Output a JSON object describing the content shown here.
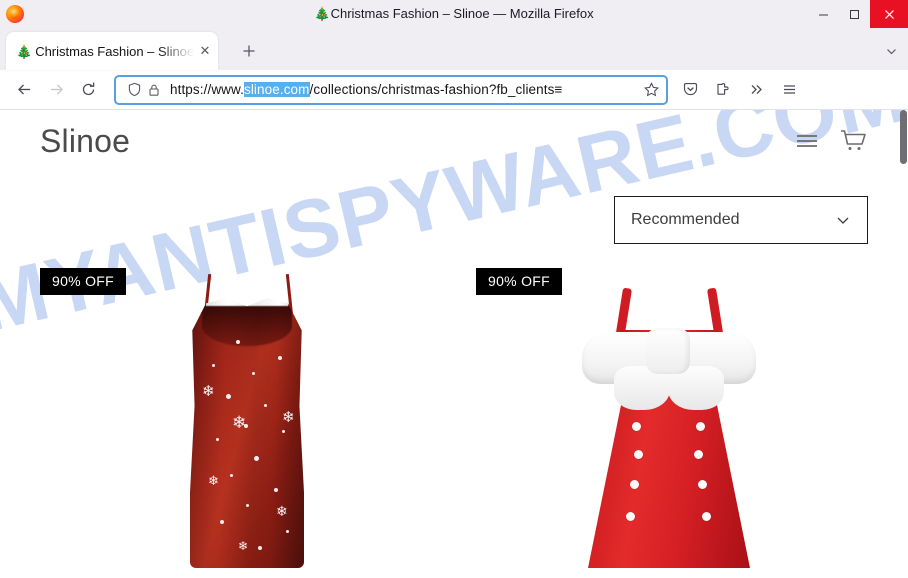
{
  "window": {
    "title": "🎄Christmas Fashion – Slinoe — Mozilla Firefox",
    "app_icon": "firefox-logo",
    "controls": {
      "minimize": "minimize-icon",
      "maximize": "maximize-icon",
      "close": "close-icon"
    }
  },
  "tabs": {
    "items": [
      {
        "favicon": "🎄",
        "title": "Christmas Fashion – Slinoe",
        "close_label": "✕",
        "active": true
      }
    ],
    "new_tab_label": "+",
    "tab_list_label": "⌄"
  },
  "toolbar": {
    "back_label": "←",
    "forward_label": "→",
    "reload_label": "⟳",
    "shield_icon": "tracking-protection-shield-icon",
    "lock_icon": "connection-secure-lock-icon",
    "url_prefix": "https://www.",
    "url_domain": "slinoe.com",
    "url_path": "/collections/christmas-fashion?fb_clients≡",
    "star_icon": "bookmark-star-icon",
    "pocket_icon": "save-to-pocket-icon",
    "extensions_icon": "extensions-puzzle-icon",
    "overflow_label": "»",
    "menu_icon": "application-menu-icon"
  },
  "page": {
    "watermark": "MYANTISPYWARE.COM",
    "watermark_color": "#b9cdf2",
    "site_logo": "Slinoe",
    "header": {
      "menu_icon": "hamburger-menu-icon",
      "cart_icon": "shopping-cart-icon"
    },
    "sort": {
      "selected": "Recommended",
      "chevron": "chevron-down-icon"
    },
    "products": [
      {
        "badge": "90% OFF",
        "badge_bg": "#000000",
        "image_alt": "dark-red-satin-snowflake-slip-dress"
      },
      {
        "badge": "90% OFF",
        "badge_bg": "#000000",
        "image_alt": "red-santa-dress-white-fur-bow"
      }
    ]
  }
}
